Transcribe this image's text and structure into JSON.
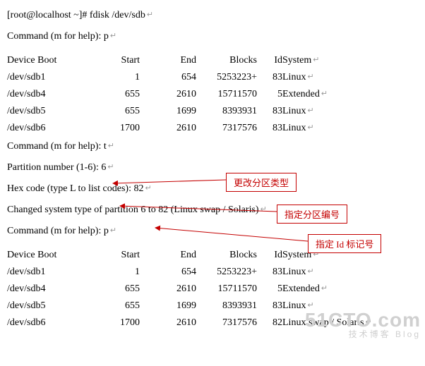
{
  "prompt_line": "[root@localhost ~]# fdisk /dev/sdb",
  "cmd_p1": "Command (m for help): p",
  "hdr": {
    "dev": "Device Boot",
    "start": "Start",
    "end": "End",
    "blocks": "Blocks",
    "id": "Id",
    "sys": "System"
  },
  "table1": [
    {
      "dev": "/dev/sdb1",
      "start": "1",
      "end": "654",
      "blocks": "5253223+",
      "id": "83",
      "sys": "Linux"
    },
    {
      "dev": "/dev/sdb4",
      "start": "655",
      "end": "2610",
      "blocks": "15711570",
      "id": "5",
      "sys": "Extended"
    },
    {
      "dev": "/dev/sdb5",
      "start": "655",
      "end": "1699",
      "blocks": "8393931",
      "id": "83",
      "sys": "Linux"
    },
    {
      "dev": "/dev/sdb6",
      "start": "1700",
      "end": "2610",
      "blocks": "7317576",
      "id": "83",
      "sys": "Linux"
    }
  ],
  "cmd_t": "Command (m for help): t",
  "part_num": "Partition number (1-6): 6",
  "hex_code": "Hex code (type L to list codes): 82",
  "changed": "Changed system type of partition 6 to 82 (Linux swap / Solaris)",
  "cmd_p2": "Command (m for help): p",
  "table2": [
    {
      "dev": "/dev/sdb1",
      "start": "1",
      "end": "654",
      "blocks": "5253223+",
      "id": "83",
      "sys": "Linux"
    },
    {
      "dev": "/dev/sdb4",
      "start": "655",
      "end": "2610",
      "blocks": "15711570",
      "id": "5",
      "sys": "Extended"
    },
    {
      "dev": "/dev/sdb5",
      "start": "655",
      "end": "1699",
      "blocks": "8393931",
      "id": "83",
      "sys": "Linux"
    },
    {
      "dev": "/dev/sdb6",
      "start": "1700",
      "end": "2610",
      "blocks": "7317576",
      "id": "82",
      "sys": "Linux swap / Solaris"
    }
  ],
  "ann1": "更改分区类型",
  "ann2": "指定分区编号",
  "ann3": "指定 Id 标记号",
  "watermark": {
    "line1": "51CTO.com",
    "line2": "技术博客   Blog"
  }
}
